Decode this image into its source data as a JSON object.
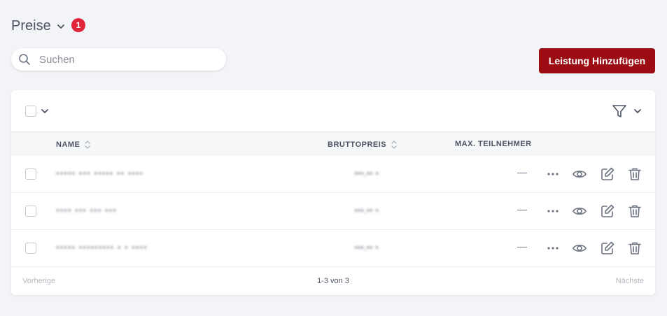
{
  "header": {
    "title": "Preise",
    "badge_count": "1"
  },
  "search": {
    "placeholder": "Suchen"
  },
  "actions": {
    "add_label": "Leistung Hinzufügen"
  },
  "table": {
    "columns": {
      "name": "NAME",
      "price": "BRUTTOPREIS",
      "max": "MAX. TEILNEHMER"
    },
    "rows": [
      {
        "name": "▪▪▪▪▪ ▪▪▪ ▪▪▪▪▪ ▪▪ ▪▪▪▪",
        "price": "▪▪▪,▪▪ ▪",
        "max": "—"
      },
      {
        "name": "▪▪▪▪ ▪▪▪ ▪▪▪ ▪▪▪",
        "price": "▪▪▪,▪▪ ▪",
        "max": "—"
      },
      {
        "name": "▪▪▪▪▪ ▪▪▪▪▪▪▪▪▪ ▪ ▪ ▪▪▪▪",
        "price": "▪▪▪,▪▪ ▪",
        "max": "—"
      }
    ]
  },
  "pagination": {
    "prev": "Vorherige",
    "info": "1-3 von 3",
    "next": "Nächste"
  },
  "colors": {
    "accent": "#9b0d12",
    "badge": "#e0243a",
    "background": "#f3f4f8"
  }
}
